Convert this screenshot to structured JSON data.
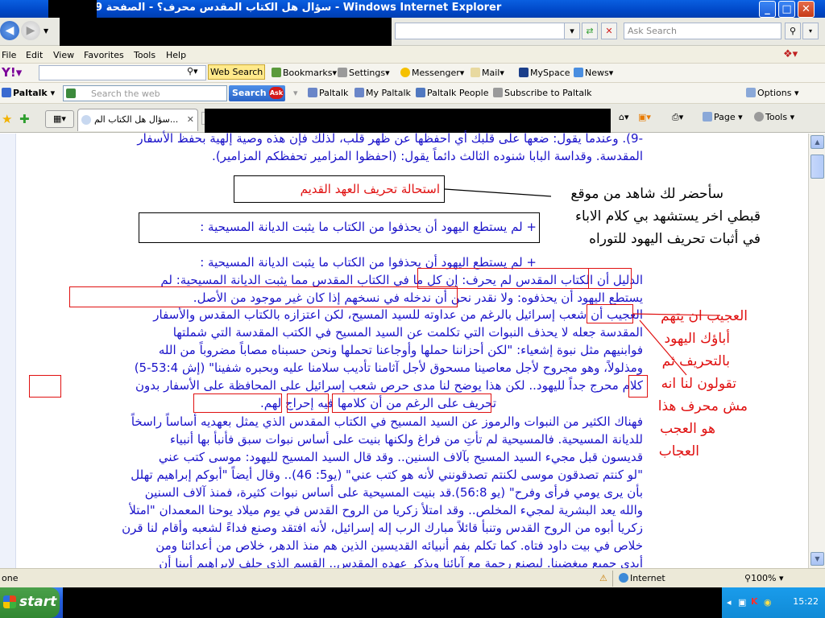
{
  "window": {
    "title": "سؤال هل الكتاب المقدس محرف؟ - الصفحة 9 - Windows Internet Explorer",
    "minimize": "_",
    "maximize": "□",
    "close": "✕"
  },
  "address_bar": {
    "search_placeholder": "Ask Search"
  },
  "menu": [
    "File",
    "Edit",
    "View",
    "Favorites",
    "Tools",
    "Help"
  ],
  "yahoo_toolbar": {
    "web_search": "Web Search",
    "bookmarks": "Bookmarks",
    "settings": "Settings",
    "messenger": "Messenger",
    "mail": "Mail",
    "myspace": "MySpace",
    "news": "News"
  },
  "paltalk_toolbar": {
    "brand": "Paltalk",
    "search_placeholder": "Search the web",
    "search_button": "Search",
    "paltalk": "Paltalk",
    "my_paltalk": "My Paltalk",
    "paltalk_people": "Paltalk People",
    "subscribe": "Subscribe to Paltalk",
    "options": "Options"
  },
  "tabs": {
    "active_tab": "سؤال هل الكتاب الم..."
  },
  "command_bar": {
    "page": "Page",
    "tools": "Tools"
  },
  "article": {
    "line1": "-9). وعندما يقول: ضعها على قلبك أي احفظها عن ظهر قلب، لذلك فإن هذه وصية إلهية بحفظ الأسفار",
    "line2": "المقدسة. وقداسة البابا شنوده الثالث دائماً يقول: (احفظوا المزامير تحفظكم المزامير).",
    "heading": "استحالة تحريف العهد القديم",
    "boxed_point": "+ لم يستطع اليهود أن يحذفوا من الكتاب ما يثبت الديانة المسيحية :",
    "point": "+ لم يستطع اليهود أن يحذفوا من الكتاب ما يثبت الديانة المسيحية :",
    "p1_l1": "الدليل أن الكتاب المقدس لم يحرف: إن كل ما في الكتاب المقدس مما يثبت الديانة المسيحية: لم",
    "p1_l2": "يستطع اليهود أن يحذفوه: ولا نقدر نحن أن ندخله في نسخهم إذا كان غير موجود من الأصل.",
    "p1_l3": "العجيب أن شعب إسرائيل بالرغم من عداوته للسيد المسيح، لكن اعتزازه بالكتاب المقدس والأسفار",
    "p1_l4": "المقدسة جعله لا يحذف النبوات التي تكلمت عن السيد المسيح في الكتب المقدسة التي شملتها",
    "p1_l5": "فوابنيهم مثل نبوة إشعياء: \"لكن أحزاننا حملها وأوجاعنا تحملها ونحن حسبناه مصاباً مضروباً من الله",
    "p1_l6": "ومذلولاً، وهو مجروح لأجل معاصينا مسحوق لأجل آثامنا تأديب سلامنا عليه وبحبره شفينا\" (إش 53:4-5)",
    "p1_l7": "كلام محرج جداً لليهود.. لكن هذا يوضح لنا مدى حرص شعب إسرائيل على المحافظة على الأسفار بدون",
    "p1_l8": "تحريف على الرغم من أن كلامها فيه إحراج لهم.",
    "p2_l1": "فهناك الكثير من النبوات والرموز عن السيد المسيح في الكتاب المقدس الذي يمثل بعهديه أساساً راسخاً",
    "p2_l2": "للديانة المسيحية. فالمسيحية لم تأتِ من فراغ ولكنها بنيت على أساس نبوات سبق فأنبأ بها أنبياء",
    "p2_l3": "قديسون قبل مجيء السيد المسيح بآلاف السنين.. وقد قال السيد المسيح لليهود: موسى كتب عني",
    "p2_l4": "\"لو كنتم تصدقون موسى لكنتم تصدقونني لأنه هو كتب عني\" (يو5: 46).. وقال أيضاً \"أبوكم إبراهيم تهلل",
    "p2_l5": "بأن يرى يومي فرأى وفرح\" (يو 56:8).قد بنيت المسيحية على أساس نبوات كثيرة، فمنذ آلاف السنين",
    "p2_l6": "والله يعد البشرية لمجيء المخلص.. وقد امتلأ زكريا من الروح القدس في يوم ميلاد يوحنا المعمدان \"امتلأ",
    "p2_l7": "زكريا أبوه من الروح القدس وتنبأ قائلاً مبارك الرب إله إسرائيل، لأنه افتقد وصنع فداءً لشعبه وأقام لنا قرن",
    "p2_l8": "خلاص في بيت داود فتاه. كما تكلم بفم أنبيائه القديسين الذين هم منذ الدهر، خلاص من أعدائنا ومن",
    "p2_l9": "أيدي جميع مبغضينا. ليصنع رحمة مع آبائنا ويذكر عهده المقدس.. القسم الذي حلف لإبراهيم أبينا أن"
  },
  "annotations": {
    "black_note": [
      "سأحضر لك شاهد من موقع",
      "قبطي اخر يستشهد بي كلام الاباء",
      "في أثبات تحريف اليهود للتوراه"
    ],
    "red_note": [
      "العجيب ان يتهم",
      "أباؤك اليهود",
      "بالتحريف ثم",
      "تقولون لنا انه",
      "مش محرف هذا",
      "هو العجب",
      "العجاب"
    ]
  },
  "status_bar": {
    "left_text": "one",
    "zone": "Internet",
    "zoom": "100%"
  },
  "taskbar": {
    "start": "start",
    "clock": "15:22"
  }
}
